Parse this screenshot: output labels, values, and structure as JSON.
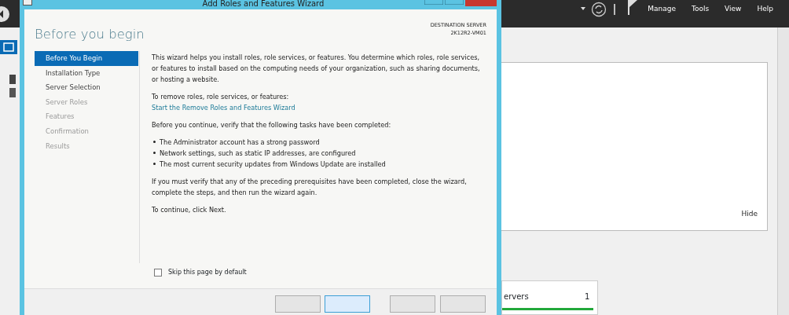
{
  "server_manager": {
    "menu": [
      "Manage",
      "Tools",
      "View",
      "Help"
    ],
    "panel_action": "Hide",
    "tile": {
      "label": "ervers",
      "count": "1",
      "level": 1
    }
  },
  "wizard": {
    "title": "Add Roles and Features Wizard",
    "heading": "Before you begin",
    "destination_label": "DESTINATION SERVER",
    "destination_server": "2K12R2-VM01",
    "steps": [
      {
        "label": "Before You Begin",
        "selected": true,
        "disabled": false
      },
      {
        "label": "Installation Type",
        "selected": false,
        "disabled": false
      },
      {
        "label": "Server Selection",
        "selected": false,
        "disabled": false
      },
      {
        "label": "Server Roles",
        "selected": false,
        "disabled": true
      },
      {
        "label": "Features",
        "selected": false,
        "disabled": true
      },
      {
        "label": "Confirmation",
        "selected": false,
        "disabled": true
      },
      {
        "label": "Results",
        "selected": false,
        "disabled": true
      }
    ],
    "intro": "This wizard helps you install roles, role services, or features. You determine which roles, role services, or features to install based on the computing needs of your organization, such as sharing documents, or hosting a website.",
    "remove_text": "To remove roles, role services, or features:",
    "remove_link": "Start the Remove Roles and Features Wizard",
    "verify_text": "Before you continue, verify that the following tasks have been completed:",
    "tasks": [
      "The Administrator account has a strong password",
      "Network settings, such as static IP addresses, are configured",
      "The most current security updates from Windows Update are installed"
    ],
    "prereq_text": "If you must verify that any of the preceding prerequisites have been completed, close the wizard, complete the steps, and then run the wizard again.",
    "continue_text": "To continue, click Next.",
    "skip": {
      "label": "Skip this page by default",
      "checked": false
    },
    "buttons": [
      {
        "kind": "normal"
      },
      {
        "kind": "default"
      },
      {
        "kind": "normal"
      },
      {
        "kind": "normal"
      }
    ]
  }
}
